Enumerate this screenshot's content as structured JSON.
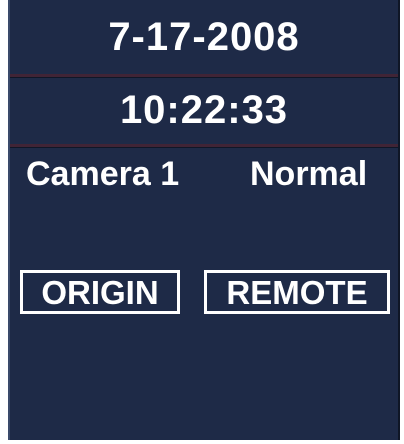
{
  "display": {
    "date": "7-17-2008",
    "time": "10:22:33",
    "camera": "Camera 1",
    "status": "Normal"
  },
  "modes": {
    "origin_label": "ORIGIN",
    "remote_label": "REMOTE"
  },
  "colors": {
    "panel_background": "#1e2a47",
    "text": "#ffffff",
    "separator": "#402436"
  }
}
